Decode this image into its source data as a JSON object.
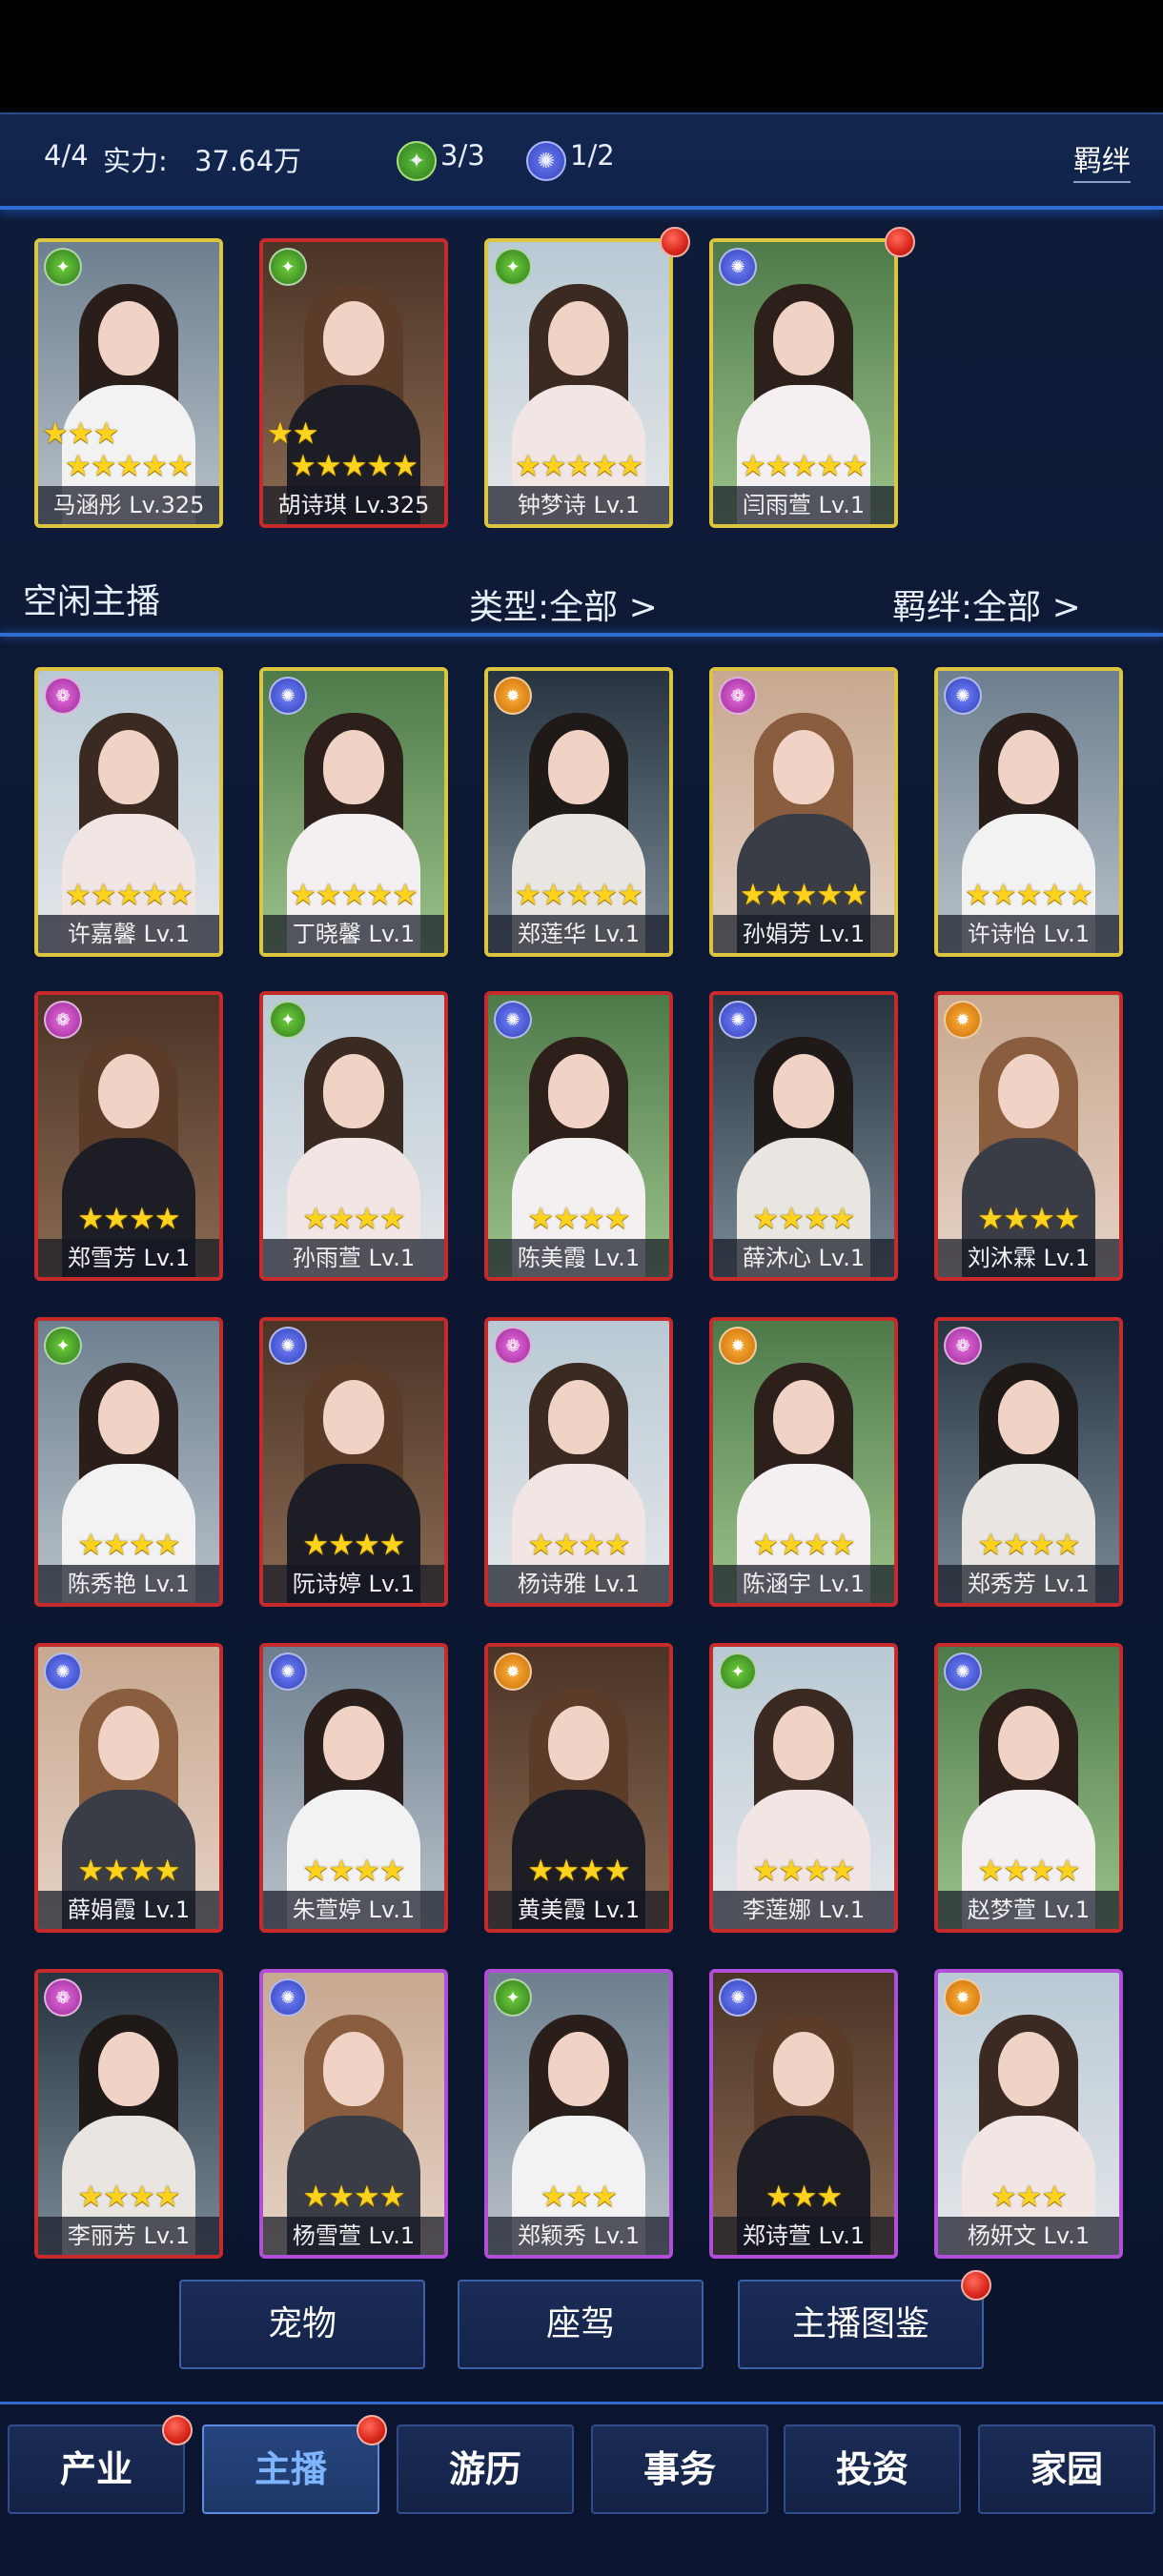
{
  "header": {
    "count": "4/4",
    "power_label": "实力:",
    "power_value": "37.64万",
    "res1_value": "3/3",
    "res2_value": "1/2",
    "bond_label": "羁绊"
  },
  "team": [
    {
      "name": "马涵彤 Lv.325",
      "stars_top": "★★★",
      "stars_bottom": "★★★★★",
      "element": "green"
    },
    {
      "name": "胡诗琪 Lv.325",
      "stars_top": "★★",
      "stars_bottom": "★★★★★",
      "element": "green"
    },
    {
      "name": "钟梦诗 Lv.1",
      "stars_bottom": "★★★★★",
      "element": "green"
    },
    {
      "name": "闫雨萱 Lv.1",
      "stars_bottom": "★★★★★",
      "element": "blue"
    }
  ],
  "idle": {
    "title": "空闲主播",
    "type_filter": "类型:全部 >",
    "bond_filter": "羁绊:全部 >"
  },
  "idle_cards": [
    {
      "name": "许嘉馨 Lv.1",
      "stars": "★★★★★",
      "element": "pink"
    },
    {
      "name": "丁晓馨 Lv.1",
      "stars": "★★★★★",
      "element": "blue"
    },
    {
      "name": "郑莲华 Lv.1",
      "stars": "★★★★★",
      "element": "orange"
    },
    {
      "name": "孙娟芳 Lv.1",
      "stars": "★★★★★",
      "element": "pink"
    },
    {
      "name": "许诗怡 Lv.1",
      "stars": "★★★★★",
      "element": "blue"
    },
    {
      "name": "郑雪芳 Lv.1",
      "stars": "★★★★",
      "element": "pink"
    },
    {
      "name": "孙雨萱 Lv.1",
      "stars": "★★★★",
      "element": "green"
    },
    {
      "name": "陈美霞 Lv.1",
      "stars": "★★★★",
      "element": "blue"
    },
    {
      "name": "薛沐心 Lv.1",
      "stars": "★★★★",
      "element": "blue"
    },
    {
      "name": "刘沐霖 Lv.1",
      "stars": "★★★★",
      "element": "orange"
    },
    {
      "name": "陈秀艳 Lv.1",
      "stars": "★★★★",
      "element": "green"
    },
    {
      "name": "阮诗婷 Lv.1",
      "stars": "★★★★",
      "element": "blue"
    },
    {
      "name": "杨诗雅 Lv.1",
      "stars": "★★★★",
      "element": "pink"
    },
    {
      "name": "陈涵宇 Lv.1",
      "stars": "★★★★",
      "element": "orange"
    },
    {
      "name": "郑秀芳 Lv.1",
      "stars": "★★★★",
      "element": "pink"
    },
    {
      "name": "薛娟霞 Lv.1",
      "stars": "★★★★",
      "element": "blue"
    },
    {
      "name": "朱萱婷 Lv.1",
      "stars": "★★★★",
      "element": "blue"
    },
    {
      "name": "黄美霞 Lv.1",
      "stars": "★★★★",
      "element": "orange"
    },
    {
      "name": "李莲娜 Lv.1",
      "stars": "★★★★",
      "element": "green"
    },
    {
      "name": "赵梦萱 Lv.1",
      "stars": "★★★★",
      "element": "blue"
    },
    {
      "name": "李丽芳 Lv.1",
      "stars": "★★★★",
      "element": "pink"
    },
    {
      "name": "杨雪萱 Lv.1",
      "stars": "★★★★",
      "element": "blue"
    },
    {
      "name": "郑颖秀 Lv.1",
      "stars": "★★★",
      "element": "green"
    },
    {
      "name": "郑诗萱 Lv.1",
      "stars": "★★★",
      "element": "blue"
    },
    {
      "name": "杨妍文 Lv.1",
      "stars": "★★★",
      "element": "orange"
    }
  ],
  "sub_buttons": {
    "pet": "宠物",
    "car": "座驾",
    "album": "主播图鉴"
  },
  "nav": {
    "industry": "产业",
    "anchor": "主播",
    "travel": "游历",
    "affairs": "事务",
    "invest": "投资",
    "home": "家园"
  },
  "colors": {
    "accent_blue": "#2f6bd0",
    "frame_gold": "#dcc640",
    "frame_red": "#c62a2a",
    "frame_purple": "#b14ed8",
    "star": "#ffd21e",
    "badge_red": "#d8261b"
  }
}
